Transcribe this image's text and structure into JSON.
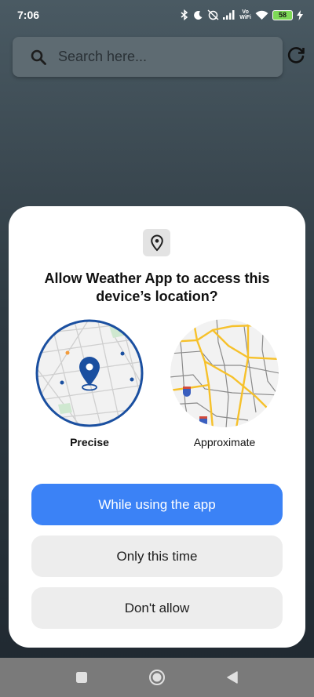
{
  "status_bar": {
    "time": "7:06",
    "battery": "58",
    "network": "Vo\nWiFi"
  },
  "search": {
    "placeholder": "Search here..."
  },
  "dialog": {
    "title": "Allow Weather App to access this device’s location?",
    "options": [
      {
        "label": "Precise",
        "selected": true
      },
      {
        "label": "Approximate",
        "selected": false
      }
    ],
    "buttons": {
      "while_using": "While using the app",
      "only_this_time": "Only this time",
      "dont_allow": "Don't allow"
    }
  },
  "colors": {
    "primary": "#3b82f6",
    "precise_ring": "#1a4fa0",
    "map_road_yellow": "#f6c12b"
  }
}
